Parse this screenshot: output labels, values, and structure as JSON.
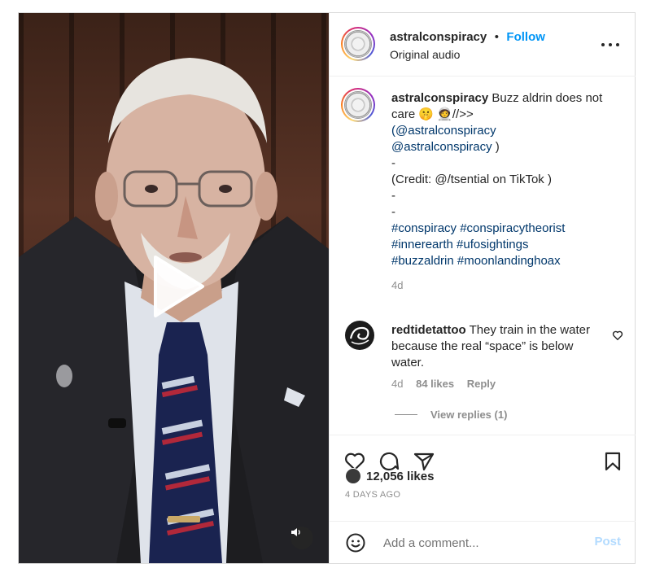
{
  "post": {
    "username": "astralconspiracy",
    "separator": "•",
    "follow_label": "Follow",
    "audio_label": "Original audio",
    "more_icon": "more-horizontal-icon"
  },
  "caption": {
    "username": "astralconspiracy",
    "line1": "Buzz aldrin does not care 🤫 🧑‍🚀//>>",
    "mention1": "(@astralconspiracy",
    "mention2": "@astralconspiracy",
    "mention2_tail": " )",
    "dash1": "-",
    "credit": "(Credit: @/tsential on TikTok )",
    "dash2": "-",
    "dash3": "-",
    "hashtags_line1": "#conspiracy #conspiracytheorist",
    "hashtags_line2": "#innerearth #ufosightings",
    "hashtags_line3": "#buzzaldrin #moonlandinghoax",
    "age": "4d"
  },
  "comment": {
    "username": "redtidetattoo",
    "text": "They train in the water because the real “space” is below water.",
    "age": "4d",
    "likes": "84 likes",
    "reply_label": "Reply",
    "view_replies": "View replies (1)"
  },
  "actions": {
    "likes": "12,056 likes",
    "timestamp": "4 DAYS AGO"
  },
  "composer": {
    "placeholder": "Add a comment...",
    "post_label": "Post"
  },
  "colors": {
    "accent": "#0095f6",
    "link": "#00376b",
    "muted": "#8e8e8e",
    "post_disabled": "#b3dbff"
  }
}
